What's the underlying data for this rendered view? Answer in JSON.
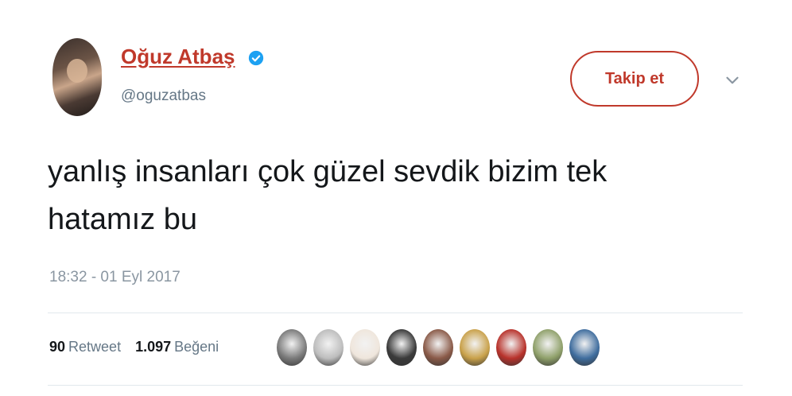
{
  "user": {
    "display_name": "Oğuz Atbaş",
    "handle": "@oguzatbas"
  },
  "follow_label": "Takip et",
  "tweet": {
    "text_line1": "yanlış insanları çok güzel sevdik bizim tek",
    "text_line2": "hatamız bu",
    "timestamp": "18:32 - 01 Eyl 2017"
  },
  "stats": {
    "retweet_count": "90",
    "retweet_label": "Retweet",
    "like_count": "1.097",
    "like_label": "Beğeni"
  },
  "likers": [
    {
      "name": "liker-1",
      "color": "#7a7a7a"
    },
    {
      "name": "liker-2",
      "color": "#bdbdbd"
    },
    {
      "name": "liker-3",
      "color": "#efe6dc"
    },
    {
      "name": "liker-4",
      "color": "#3a3a3a"
    },
    {
      "name": "liker-5",
      "color": "#8a5a48"
    },
    {
      "name": "liker-6",
      "color": "#c9a14a"
    },
    {
      "name": "liker-7",
      "color": "#b8322b"
    },
    {
      "name": "liker-8",
      "color": "#8fa06a"
    },
    {
      "name": "liker-9",
      "color": "#3f6d9e"
    }
  ],
  "colors": {
    "accent": "#c0392b",
    "verified": "#1da1f2",
    "muted": "#657786"
  }
}
